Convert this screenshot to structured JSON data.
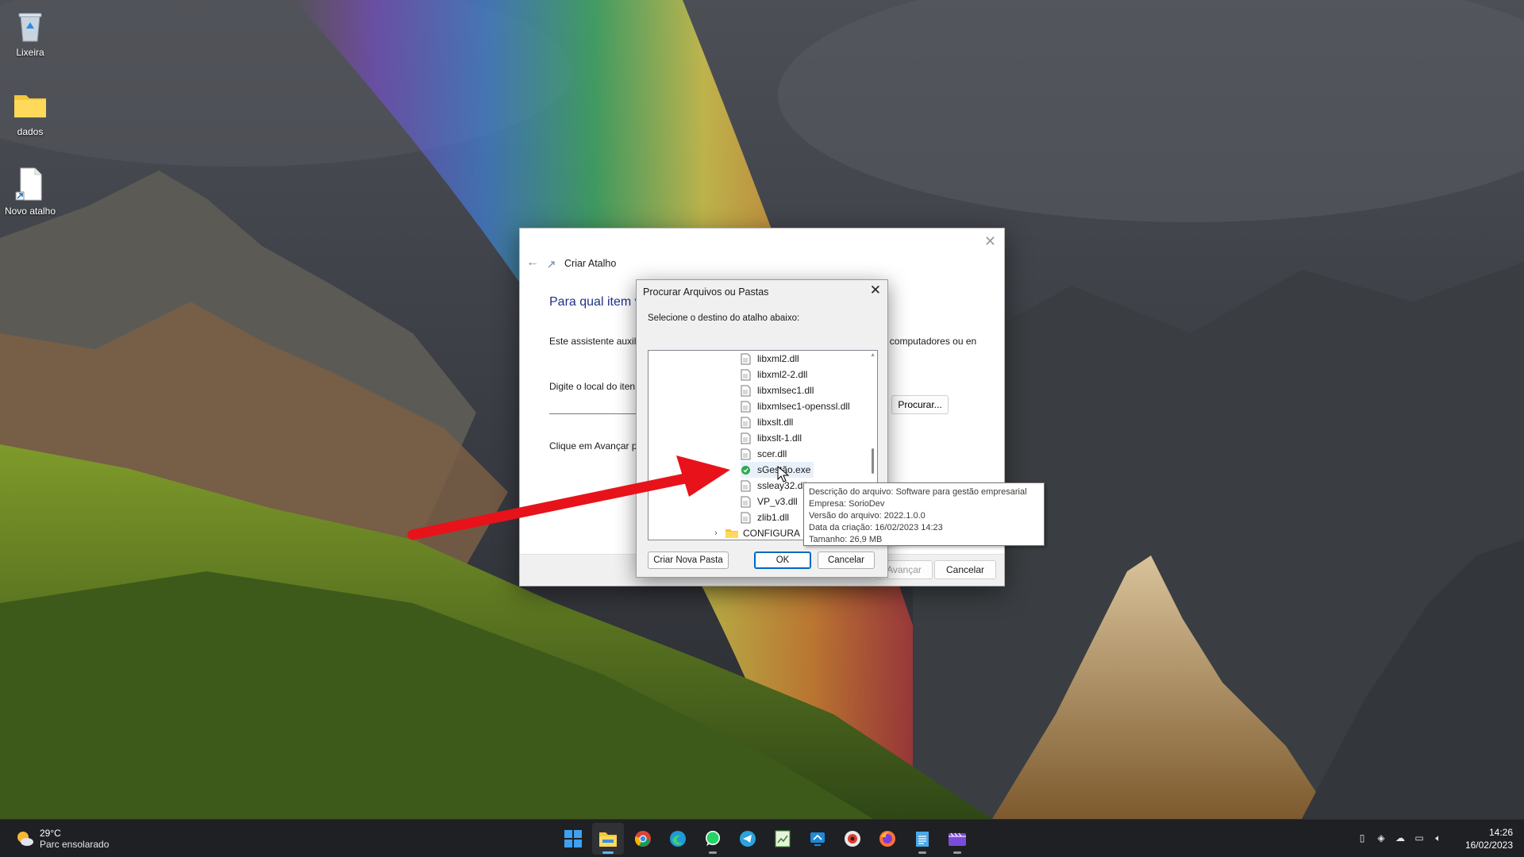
{
  "desktop": {
    "icons": [
      {
        "label": "Lixeira",
        "icon": "recycle-bin-icon"
      },
      {
        "label": "dados",
        "icon": "folder-icon"
      },
      {
        "label": "Novo atalho",
        "icon": "shortcut-file-icon"
      }
    ]
  },
  "wizard": {
    "title": "Criar Atalho",
    "heading": "Para qual item v",
    "description": "Este assistente auxili                                                                        uivos, pastas, computadores ou en",
    "location_label": "Digite o local do iten",
    "browse_button": "Procurar...",
    "next_hint": "Clique em Avançar p",
    "next_button": "Avançar",
    "cancel_button": "Cancelar"
  },
  "browse_dialog": {
    "title": "Procurar Arquivos ou Pastas",
    "instruction": "Selecione o destino do atalho abaixo:",
    "files": [
      {
        "name": "libxml2.dll",
        "type": "dll"
      },
      {
        "name": "libxml2-2.dll",
        "type": "dll"
      },
      {
        "name": "libxmlsec1.dll",
        "type": "dll"
      },
      {
        "name": "libxmlsec1-openssl.dll",
        "type": "dll"
      },
      {
        "name": "libxslt.dll",
        "type": "dll"
      },
      {
        "name": "libxslt-1.dll",
        "type": "dll"
      },
      {
        "name": "scer.dll",
        "type": "dll"
      },
      {
        "name": "sGestão.exe",
        "type": "exe",
        "selected": true
      },
      {
        "name": "ssleay32.dll",
        "type": "dll"
      },
      {
        "name": "VP_v3.dll",
        "type": "dll"
      },
      {
        "name": "zlib1.dll",
        "type": "dll"
      }
    ],
    "folder": {
      "name": "CONFIGURA",
      "icon": "folder-icon"
    },
    "new_folder_button": "Criar Nova Pasta",
    "ok_button": "OK",
    "cancel_button": "Cancelar"
  },
  "tooltip": {
    "lines": [
      "Descrição do arquivo: Software para gestão empresarial",
      "Empresa: SorioDev",
      "Versão do arquivo: 2022.1.0.0",
      "Data da criação: 16/02/2023 14:23",
      "Tamanho: 26,9 MB"
    ]
  },
  "taskbar": {
    "weather": {
      "temp": "29°C",
      "condition": "Parc ensolarado"
    },
    "apps": [
      {
        "name": "windows-start-icon"
      },
      {
        "name": "file-explorer-icon",
        "active": true
      },
      {
        "name": "chrome-icon"
      },
      {
        "name": "edge-icon"
      },
      {
        "name": "whatsapp-icon"
      },
      {
        "name": "telegram-icon"
      },
      {
        "name": "spreadsheet-icon"
      },
      {
        "name": "remote-app-icon"
      },
      {
        "name": "record-app-icon"
      },
      {
        "name": "firefox-icon"
      },
      {
        "name": "notepad-icon"
      },
      {
        "name": "video-editor-icon"
      }
    ],
    "clock": {
      "time": "14:26",
      "date": "16/02/2023"
    }
  },
  "colors": {
    "accent": "#0067c0",
    "arrow": "#e8121a",
    "taskbar": "#1f2023"
  }
}
